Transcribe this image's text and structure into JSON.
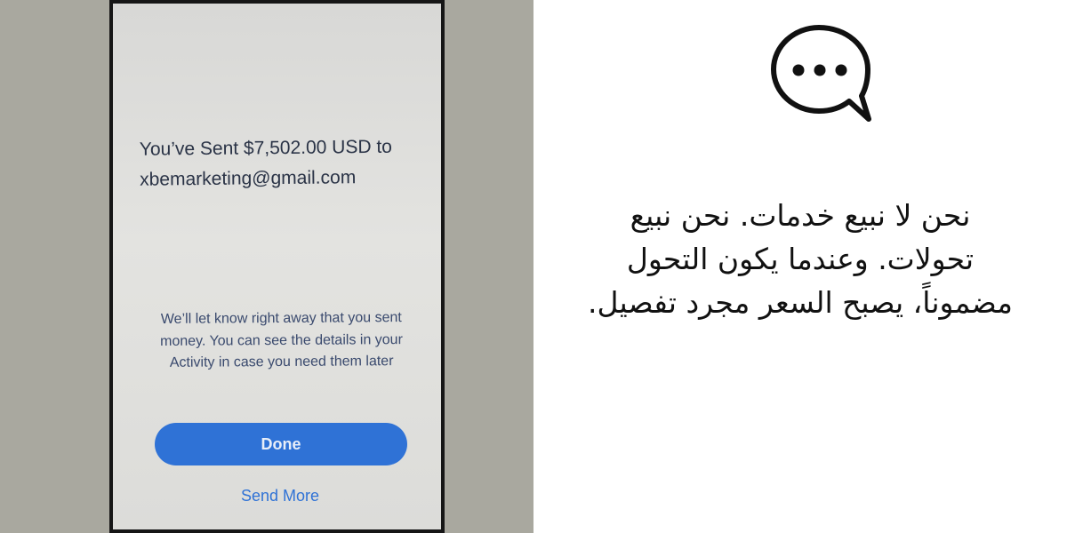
{
  "screenshot": {
    "title_line1": "You’ve Sent $7,502.00 USD to",
    "title_line2": "xbemarketing@gmail.com",
    "notice_lines": [
      "We’ll let know right away that you sent",
      "money. You can see the details in your",
      "Activity in case you need them later"
    ],
    "done_label": "Done",
    "send_more_label": "Send More"
  },
  "quote": {
    "lines": [
      "نحن لا نبيع خدمات. نحن نبيع",
      "تحولات. وعندما يكون التحول",
      "مضموناً، يصبح السعر مجرد تفصيل."
    ]
  },
  "icons": {
    "chat": "speech-bubble-ellipsis-icon"
  },
  "colors": {
    "accent_blue": "#2f72d6",
    "photo_background": "#a9a89f",
    "phone_bezel": "#161616",
    "text_dark": "#111111"
  }
}
